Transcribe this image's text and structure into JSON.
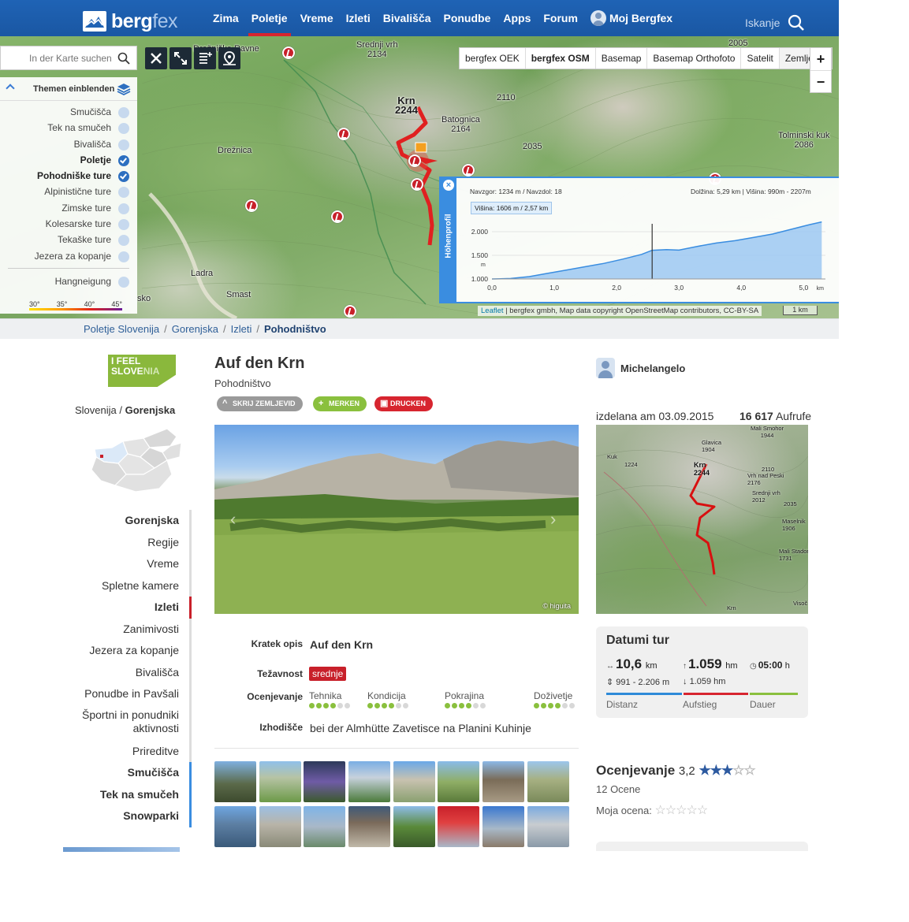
{
  "header": {
    "logo_text": "bergfex",
    "nav": [
      "Zima",
      "Poletje",
      "Vreme",
      "Izleti",
      "Bivališča",
      "Ponudbe",
      "Apps",
      "Forum"
    ],
    "nav_active": "Poletje",
    "user_label": "Moj Bergfex",
    "search_label": "Iskanje"
  },
  "map": {
    "search_placeholder": "In der Karte suchen",
    "themes_title": "Themen einblenden",
    "themes": [
      {
        "label": "Smučišča",
        "on": false
      },
      {
        "label": "Tek na smučeh",
        "on": false
      },
      {
        "label": "Bivališča",
        "on": false
      },
      {
        "label": "Poletje",
        "on": true
      },
      {
        "label": "Pohodniške ture",
        "on": true
      },
      {
        "label": "Alpinistične ture",
        "on": false
      },
      {
        "label": "Zimske ture",
        "on": false
      },
      {
        "label": "Kolesarske ture",
        "on": false
      },
      {
        "label": "Tekaške ture",
        "on": false
      },
      {
        "label": "Jezera za kopanje",
        "on": false
      }
    ],
    "slope_label": "Hangneigung",
    "slope_steps": [
      "30°",
      "35°",
      "40°",
      "45°"
    ],
    "layers": [
      "bergfex OEK",
      "bergfex OSM",
      "Basemap",
      "Basemap Orthofoto",
      "Satelit",
      "Zemljevid"
    ],
    "layer_active": "bergfex OSM",
    "zoom_in": "+",
    "zoom_out": "−",
    "labels": [
      {
        "text": "Srednji vrh\n2134"
      },
      {
        "text": "Drežniške Ravne"
      },
      {
        "text": "Krn\n2244"
      },
      {
        "text": "Batognica\n2164"
      },
      {
        "text": "2110"
      },
      {
        "text": "2005"
      },
      {
        "text": "Drežnica"
      },
      {
        "text": "2035"
      },
      {
        "text": "Tolminski kuk\n2086"
      },
      {
        "text": "Ladra"
      },
      {
        "text": "Smast"
      },
      {
        "text": "sko"
      }
    ],
    "profile": {
      "tab_label": "Höhenprofil",
      "close": "×",
      "ascent_descent": "Navzgor: 1234 m / Navzdol: 18",
      "length_height": "Dolžina: 5,29 km | Višina: 990m - 2207m",
      "tooltip": "Višina: 1606 m / 2,57 km",
      "y_unit": "m",
      "x_unit": "km",
      "y_ticks": [
        "2.000",
        "1.500",
        "1.000"
      ],
      "x_ticks": [
        "0,0",
        "1,0",
        "2,0",
        "3,0",
        "4,0",
        "5,0"
      ],
      "cursor_km": 2.57,
      "points": [
        [
          0,
          1000
        ],
        [
          0.3,
          1010
        ],
        [
          0.6,
          1050
        ],
        [
          0.9,
          1120
        ],
        [
          1.2,
          1190
        ],
        [
          1.5,
          1260
        ],
        [
          1.8,
          1330
        ],
        [
          2.1,
          1420
        ],
        [
          2.4,
          1520
        ],
        [
          2.57,
          1606
        ],
        [
          2.8,
          1620
        ],
        [
          3.0,
          1610
        ],
        [
          3.3,
          1690
        ],
        [
          3.6,
          1760
        ],
        [
          3.9,
          1810
        ],
        [
          4.2,
          1880
        ],
        [
          4.5,
          1950
        ],
        [
          4.8,
          2050
        ],
        [
          5.1,
          2150
        ],
        [
          5.29,
          2207
        ]
      ]
    },
    "attribution_leaflet": "Leaflet",
    "attribution": " | bergfex gmbh, Map data copyright OpenStreetMap contributors, CC-BY-SA",
    "scale": "1 km"
  },
  "breadcrumb": [
    "Poletje Slovenija",
    "Gorenjska",
    "Izleti",
    "Pohodništvo"
  ],
  "breadcrumb_current": "Pohodništvo",
  "left": {
    "logo_line1": "I FEEL",
    "logo_line2a": "SLOVE",
    "logo_line2b": "NIA",
    "country": "Slovenija",
    "region": "Gorenjska",
    "nav": [
      {
        "label": "Gorenjska",
        "kind": "hd"
      },
      {
        "label": "Regije",
        "kind": ""
      },
      {
        "label": "Vreme",
        "kind": ""
      },
      {
        "label": "Spletne kamere",
        "kind": ""
      },
      {
        "label": "Izleti",
        "kind": "act"
      },
      {
        "label": "Zanimivosti",
        "kind": ""
      },
      {
        "label": "Jezera za kopanje",
        "kind": ""
      },
      {
        "label": "Bivališča",
        "kind": ""
      },
      {
        "label": "Ponudbe in Pavšali",
        "kind": ""
      },
      {
        "label": "Športni in ponudniki aktivnosti",
        "kind": ""
      },
      {
        "label": "Prireditve",
        "kind": ""
      },
      {
        "label": "Smučišča",
        "kind": "ski"
      },
      {
        "label": "Tek na smučeh",
        "kind": "ski"
      },
      {
        "label": "Snowparki",
        "kind": "ski"
      }
    ]
  },
  "tour": {
    "title": "Auf den Krn",
    "type": "Pohodništvo",
    "btn_hide_map": "SKRIJ ZEMLJEVID",
    "btn_remember": "MERKEN",
    "btn_print": "DRUCKEN",
    "photo_credit": "© higuita",
    "short_desc_label": "Kratek opis",
    "short_desc": "Auf den Krn",
    "difficulty_label": "Težavnost",
    "difficulty": "srednje",
    "rating_label": "Ocenjevanje",
    "ratings": [
      {
        "label": "Tehnika",
        "value": 4
      },
      {
        "label": "Kondicija",
        "value": 4
      },
      {
        "label": "Pokrajina",
        "value": 4
      },
      {
        "label": "Doživetje",
        "value": 4
      }
    ],
    "rating_max": 6,
    "start_label": "Izhodišče",
    "start": "bei der Almhütte Zavetisce na Planini Kuhinje"
  },
  "side": {
    "author": "Michelangelo",
    "created": "izdelana am 03.09.2015",
    "views_num": "16 617",
    "views_label": "Aufrufe",
    "minimap_labels": [
      "Mali Smohor\n1944",
      "Glavica\n1904",
      "Krn\n2244",
      "2110",
      "Vrh nad Peski\n2176",
      "Srednji vrh\n2012",
      "2035",
      "Maselnik\n1906",
      "Mali Stador\n1731",
      "Krn",
      "1224",
      "Kuk",
      "Visoč"
    ],
    "stats_title": "Datumi tur",
    "distance": "10,6",
    "distance_unit": "km",
    "ascent": "1.059",
    "ascent_unit": "hm",
    "duration": "05:00",
    "duration_unit": "h",
    "alt_range": "991 - 2.206 m",
    "descent": "1.059 hm",
    "bar_labels": [
      "Distanz",
      "Aufstieg",
      "Dauer"
    ],
    "bar_colors": [
      "#2e8ad8",
      "#d7252f",
      "#8ac03e"
    ],
    "rating_title": "Ocenjevanje",
    "rating_value": "3,2",
    "rating_stars": 3,
    "rating_count": "12 Ocene",
    "my_rating_label": "Moja ocena:"
  }
}
